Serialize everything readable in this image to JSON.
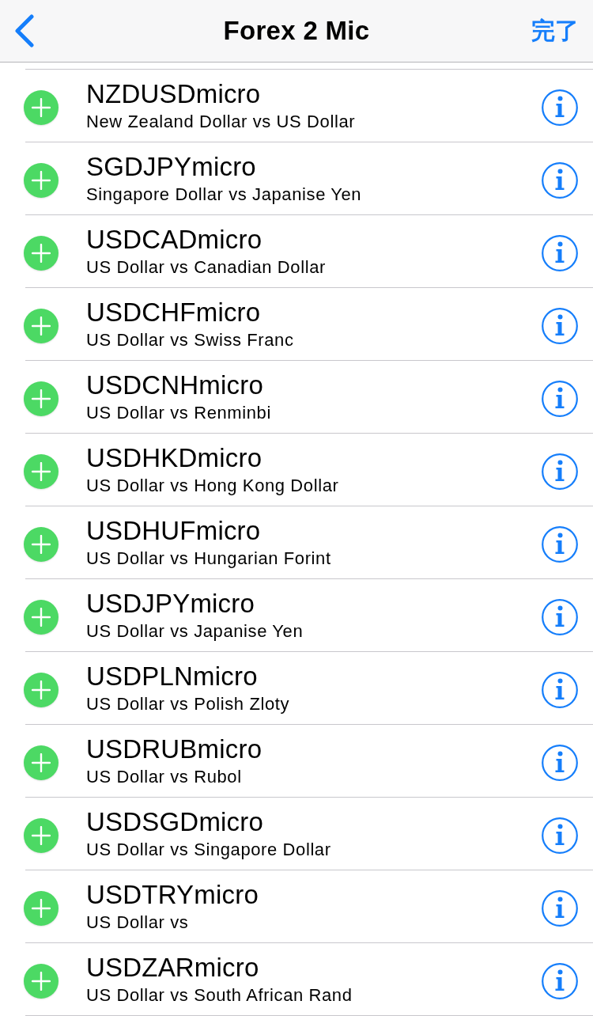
{
  "navigation_bar": {
    "title": "Forex 2 Mic",
    "done_label": "完了"
  },
  "symbols": [
    {
      "name": "NZDUSDmicro",
      "description": "New Zealand Dollar vs US Dollar"
    },
    {
      "name": "SGDJPYmicro",
      "description": "Singapore Dollar vs Japanise Yen"
    },
    {
      "name": "USDCADmicro",
      "description": "US Dollar vs Canadian Dollar"
    },
    {
      "name": "USDCHFmicro",
      "description": "US Dollar vs Swiss Franc"
    },
    {
      "name": "USDCNHmicro",
      "description": "US Dollar vs Renminbi"
    },
    {
      "name": "USDHKDmicro",
      "description": "US Dollar vs Hong Kong Dollar"
    },
    {
      "name": "USDHUFmicro",
      "description": "US Dollar vs Hungarian Forint"
    },
    {
      "name": "USDJPYmicro",
      "description": "US Dollar vs Japanise Yen"
    },
    {
      "name": "USDPLNmicro",
      "description": "US Dollar vs Polish Zloty"
    },
    {
      "name": "USDRUBmicro",
      "description": "US Dollar vs Rubol"
    },
    {
      "name": "USDSGDmicro",
      "description": "US Dollar vs Singapore Dollar"
    },
    {
      "name": "USDTRYmicro",
      "description": "US Dollar vs"
    },
    {
      "name": "USDZARmicro",
      "description": "US Dollar vs South African Rand"
    }
  ]
}
